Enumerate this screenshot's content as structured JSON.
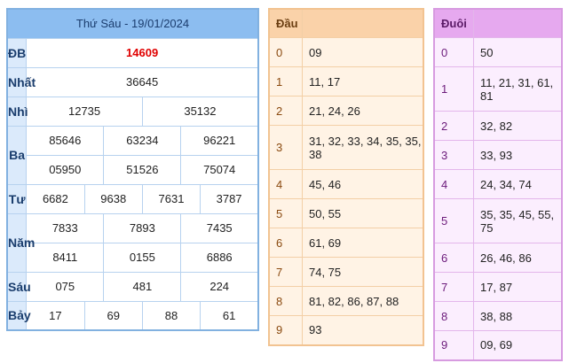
{
  "results": {
    "title": "Thứ Sáu - 19/01/2024",
    "rows": [
      {
        "label": "ĐB",
        "values": [
          "14609"
        ]
      },
      {
        "label": "Nhất",
        "values": [
          "36645"
        ]
      },
      {
        "label": "Nhì",
        "values": [
          "12735",
          "35132"
        ]
      },
      {
        "label": "Ba",
        "values": [
          "85646",
          "63234",
          "96221",
          "05950",
          "51526",
          "75074"
        ]
      },
      {
        "label": "Tư",
        "values": [
          "6682",
          "9638",
          "7631",
          "3787"
        ]
      },
      {
        "label": "Năm",
        "values": [
          "7833",
          "7893",
          "7435",
          "8411",
          "0155",
          "6886"
        ]
      },
      {
        "label": "Sáu",
        "values": [
          "075",
          "481",
          "224"
        ]
      },
      {
        "label": "Bảy",
        "values": [
          "17",
          "69",
          "88",
          "61"
        ]
      }
    ]
  },
  "dau": {
    "header": "Đầu",
    "rows": [
      {
        "key": "0",
        "value": "09"
      },
      {
        "key": "1",
        "value": "11, 17"
      },
      {
        "key": "2",
        "value": "21, 24, 26"
      },
      {
        "key": "3",
        "value": "31, 32, 33, 34, 35, 35, 38"
      },
      {
        "key": "4",
        "value": "45, 46"
      },
      {
        "key": "5",
        "value": "50, 55"
      },
      {
        "key": "6",
        "value": "61, 69"
      },
      {
        "key": "7",
        "value": "74, 75"
      },
      {
        "key": "8",
        "value": "81, 82, 86, 87, 88"
      },
      {
        "key": "9",
        "value": "93"
      }
    ]
  },
  "duoi": {
    "header": "Đuôi",
    "rows": [
      {
        "key": "0",
        "value": "50"
      },
      {
        "key": "1",
        "value": "11, 21, 31, 61, 81"
      },
      {
        "key": "2",
        "value": "32, 82"
      },
      {
        "key": "3",
        "value": "33, 93"
      },
      {
        "key": "4",
        "value": "24, 34, 74"
      },
      {
        "key": "5",
        "value": "35, 35, 45, 55, 75"
      },
      {
        "key": "6",
        "value": "26, 46, 86"
      },
      {
        "key": "7",
        "value": "17, 87"
      },
      {
        "key": "8",
        "value": "38, 88"
      },
      {
        "key": "9",
        "value": "09, 69"
      }
    ]
  }
}
